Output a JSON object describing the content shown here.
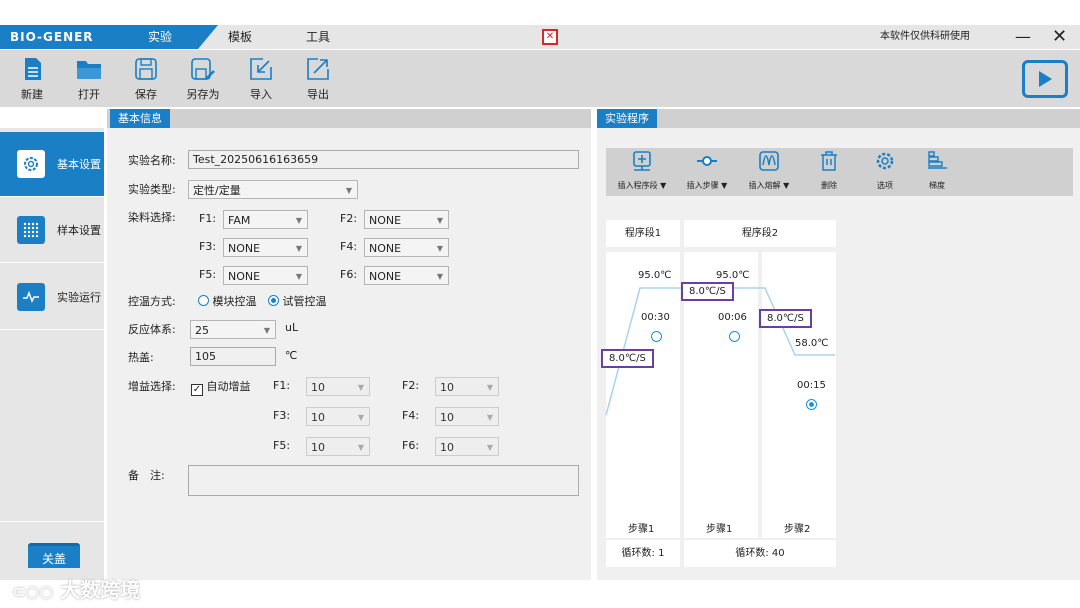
{
  "app": {
    "brand": "BIO-GENER",
    "notice": "本软件仅供科研使用",
    "tabs": [
      "实验",
      "模板",
      "工具"
    ],
    "active_tab": "实验",
    "accent": "#1a7fc4"
  },
  "toolbar": [
    {
      "label": "新建",
      "icon": "new-file-icon"
    },
    {
      "label": "打开",
      "icon": "folder-open-icon"
    },
    {
      "label": "保存",
      "icon": "save-icon"
    },
    {
      "label": "另存为",
      "icon": "save-as-icon"
    },
    {
      "label": "导入",
      "icon": "import-icon"
    },
    {
      "label": "导出",
      "icon": "export-icon"
    }
  ],
  "sidebar": {
    "items": [
      {
        "label": "基本设置",
        "icon": "gear-icon",
        "active": true
      },
      {
        "label": "样本设置",
        "icon": "grid-icon"
      },
      {
        "label": "实验运行",
        "icon": "pulse-icon"
      }
    ],
    "lid_button": "关盖"
  },
  "basic": {
    "header": "基本信息",
    "name_label": "实验名称:",
    "name_value": "Test_20250616163659",
    "type_label": "实验类型:",
    "type_value": "定性/定量",
    "dye_label": "染料选择:",
    "dyes": [
      {
        "k": "F1:",
        "v": "FAM"
      },
      {
        "k": "F2:",
        "v": "NONE"
      },
      {
        "k": "F3:",
        "v": "NONE"
      },
      {
        "k": "F4:",
        "v": "NONE"
      },
      {
        "k": "F5:",
        "v": "NONE"
      },
      {
        "k": "F6:",
        "v": "NONE"
      }
    ],
    "temp_label": "控温方式:",
    "temp_opt1": "模块控温",
    "temp_opt2": "试管控温",
    "temp_selected": "试管控温",
    "volume_label": "反应体系:",
    "volume_value": "25",
    "volume_unit": "uL",
    "lid_label": "热盖:",
    "lid_value": "105",
    "lid_unit": "℃",
    "gain_label": "增益选择:",
    "auto_gain": "自动增益",
    "auto_gain_checked": true,
    "gains": [
      {
        "k": "F1:",
        "v": "10"
      },
      {
        "k": "F2:",
        "v": "10"
      },
      {
        "k": "F3:",
        "v": "10"
      },
      {
        "k": "F4:",
        "v": "10"
      },
      {
        "k": "F5:",
        "v": "10"
      },
      {
        "k": "F6:",
        "v": "10"
      }
    ],
    "note_label": "备　注:",
    "note_value": ""
  },
  "program": {
    "header": "实验程序",
    "tools": [
      {
        "label": "插入程序段 ▼",
        "icon": "insert-segment-icon"
      },
      {
        "label": "插入步骤 ▼",
        "icon": "insert-step-icon"
      },
      {
        "label": "插入熔解 ▼",
        "icon": "insert-melt-icon"
      },
      {
        "label": "删除",
        "icon": "trash-icon"
      },
      {
        "label": "选项",
        "icon": "gear-icon"
      },
      {
        "label": "梯度",
        "icon": "gradient-icon"
      }
    ],
    "segments": [
      {
        "name": "程序段1",
        "cycles": "循环数:  1"
      },
      {
        "name": "程序段2",
        "cycles": "循环数:  40"
      }
    ],
    "steps": [
      {
        "label": "步骤1",
        "temp": "95.0℃",
        "time": "00:30",
        "rate": "8.0℃/S",
        "selected": false
      },
      {
        "label": "步骤1",
        "temp": "95.0℃",
        "time": "00:06",
        "rate": "8.0℃/S",
        "selected": false
      },
      {
        "label": "步骤2",
        "temp": "58.0℃",
        "time": "00:15",
        "rate": "8.0℃/S",
        "selected": true
      }
    ]
  },
  "watermark": "大数跨境"
}
